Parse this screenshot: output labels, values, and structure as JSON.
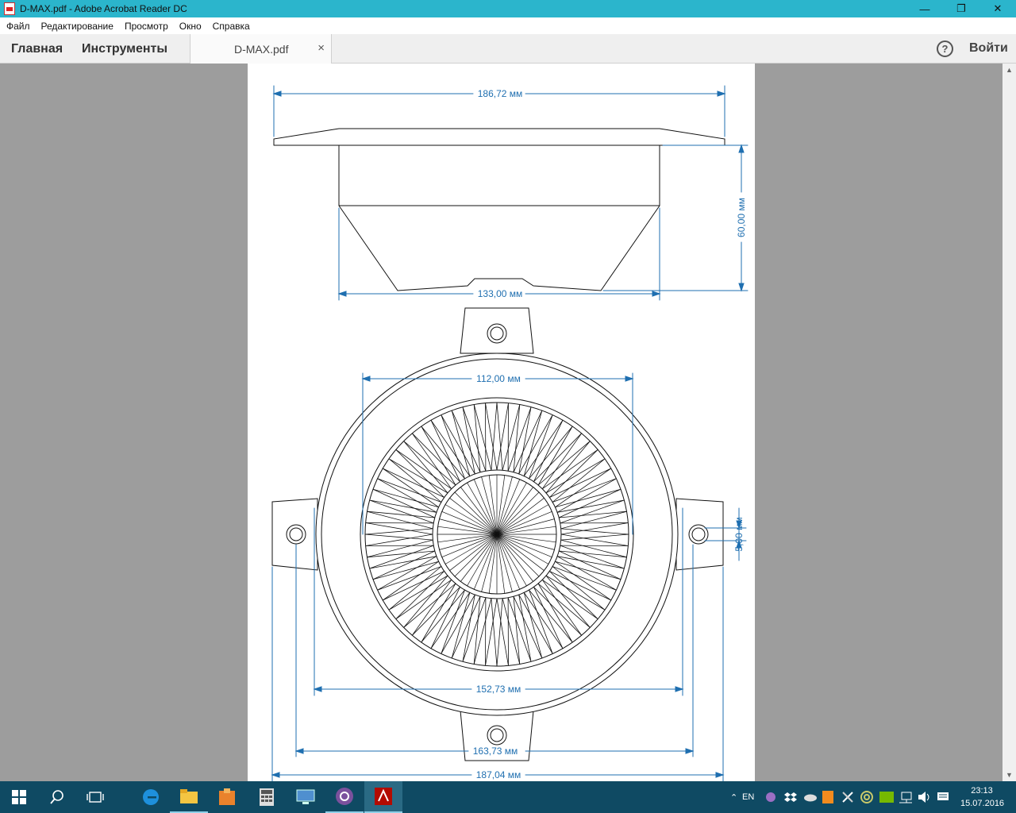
{
  "window": {
    "title": "D-MAX.pdf - Adobe Acrobat Reader DC",
    "controls": {
      "minimize": "—",
      "restore": "❐",
      "close": "✕"
    }
  },
  "menu": [
    "Файл",
    "Редактирование",
    "Просмотр",
    "Окно",
    "Справка"
  ],
  "tabs": {
    "home": "Главная",
    "tools": "Инструменты",
    "document": "D-MAX.pdf",
    "close": "×"
  },
  "header": {
    "help": "?",
    "signin": "Войти"
  },
  "drawing": {
    "dim_top_width": "186,72 мм",
    "dim_height": "60,00 мм",
    "dim_bottom_width": "133,00 мм",
    "dim_inner": "112,00 мм",
    "dim_hole": "5,00 мм",
    "dim_body": "152,73 мм",
    "dim_holes_span": "163,73 мм",
    "dim_overall": "187,04 мм"
  },
  "taskbar": {
    "language": "EN",
    "time": "23:13",
    "date": "15.07.2016"
  },
  "colors": {
    "titlebar": "#2bb5cc",
    "taskbar": "#0f4a63",
    "dimension": "#1f6fb0"
  }
}
